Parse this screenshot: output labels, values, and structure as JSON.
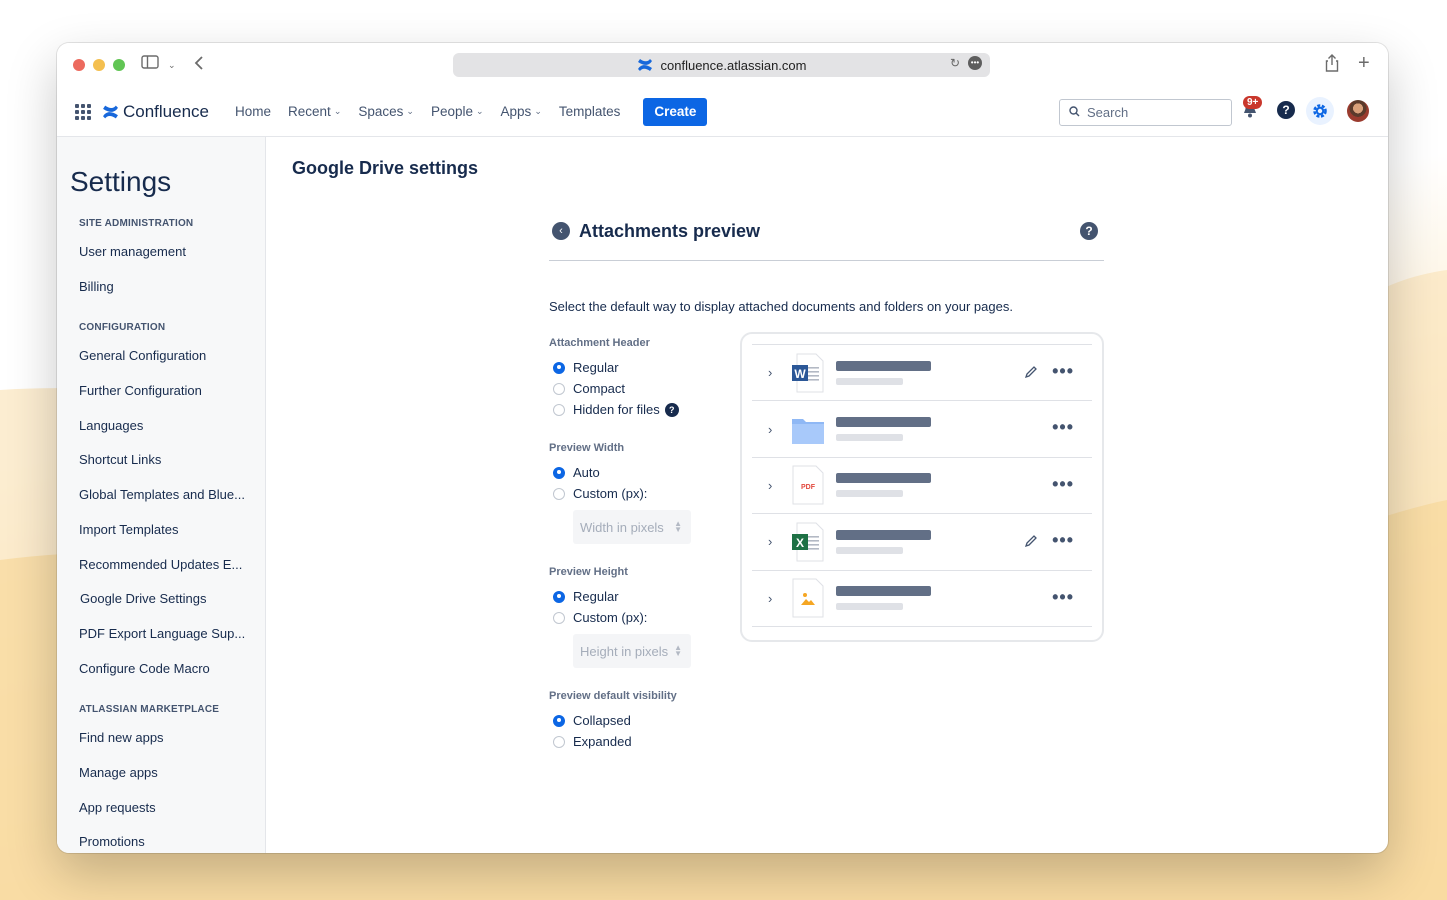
{
  "browser": {
    "url": "confluence.atlassian.com"
  },
  "nav": {
    "brand": "Confluence",
    "items": [
      {
        "label": "Home",
        "dropdown": false
      },
      {
        "label": "Recent",
        "dropdown": true
      },
      {
        "label": "Spaces",
        "dropdown": true
      },
      {
        "label": "People",
        "dropdown": true
      },
      {
        "label": "Apps",
        "dropdown": true
      },
      {
        "label": "Templates",
        "dropdown": false
      }
    ],
    "create_label": "Create",
    "search_placeholder": "Search",
    "notification_badge": "9+"
  },
  "sidebar": {
    "title": "Settings",
    "sections": [
      {
        "heading": "SITE ADMINISTRATION",
        "items": [
          "User management",
          "Billing"
        ]
      },
      {
        "heading": "CONFIGURATION",
        "items": [
          "General Configuration",
          "Further Configuration",
          "Languages",
          "Shortcut Links",
          "Global Templates and Blue...",
          "Import Templates",
          "Recommended Updates E...",
          "Google Drive Settings",
          "PDF Export Language Sup...",
          "Configure Code Macro"
        ]
      },
      {
        "heading": "ATLASSIAN MARKETPLACE",
        "items": [
          "Find new apps",
          "Manage apps",
          "App requests",
          "Promotions"
        ]
      }
    ],
    "active_item": "Google Drive Settings"
  },
  "page": {
    "title": "Google Drive settings",
    "panel_title": "Attachments preview",
    "description": "Select the default way to display attached documents and folders on your pages.",
    "groups": [
      {
        "label": "Attachment Header",
        "options": [
          "Regular",
          "Compact",
          "Hidden for files"
        ],
        "selected": 0,
        "help_on": 2,
        "input_placeholder": ""
      },
      {
        "label": "Preview Width",
        "options": [
          "Auto",
          "Custom (px):"
        ],
        "selected": 0,
        "help_on": -1,
        "input_placeholder": "Width in pixels"
      },
      {
        "label": "Preview Height",
        "options": [
          "Regular",
          "Custom (px):"
        ],
        "selected": 0,
        "help_on": -1,
        "input_placeholder": "Height in pixels"
      },
      {
        "label": "Preview default visibility",
        "options": [
          "Collapsed",
          "Expanded"
        ],
        "selected": 0,
        "help_on": -1,
        "input_placeholder": ""
      }
    ],
    "preview_rows": [
      {
        "icon": "word-doc-icon",
        "editable": true
      },
      {
        "icon": "folder-icon",
        "editable": false
      },
      {
        "icon": "pdf-icon",
        "editable": false
      },
      {
        "icon": "excel-sheet-icon",
        "editable": true
      },
      {
        "icon": "image-file-icon",
        "editable": false
      }
    ],
    "pdf_glyph": "PDF"
  },
  "colors": {
    "accent": "#0c66e4",
    "badge": "#c9372c",
    "folder": "#8fb8f5",
    "word": "#2b5797",
    "excel": "#1e7145"
  }
}
